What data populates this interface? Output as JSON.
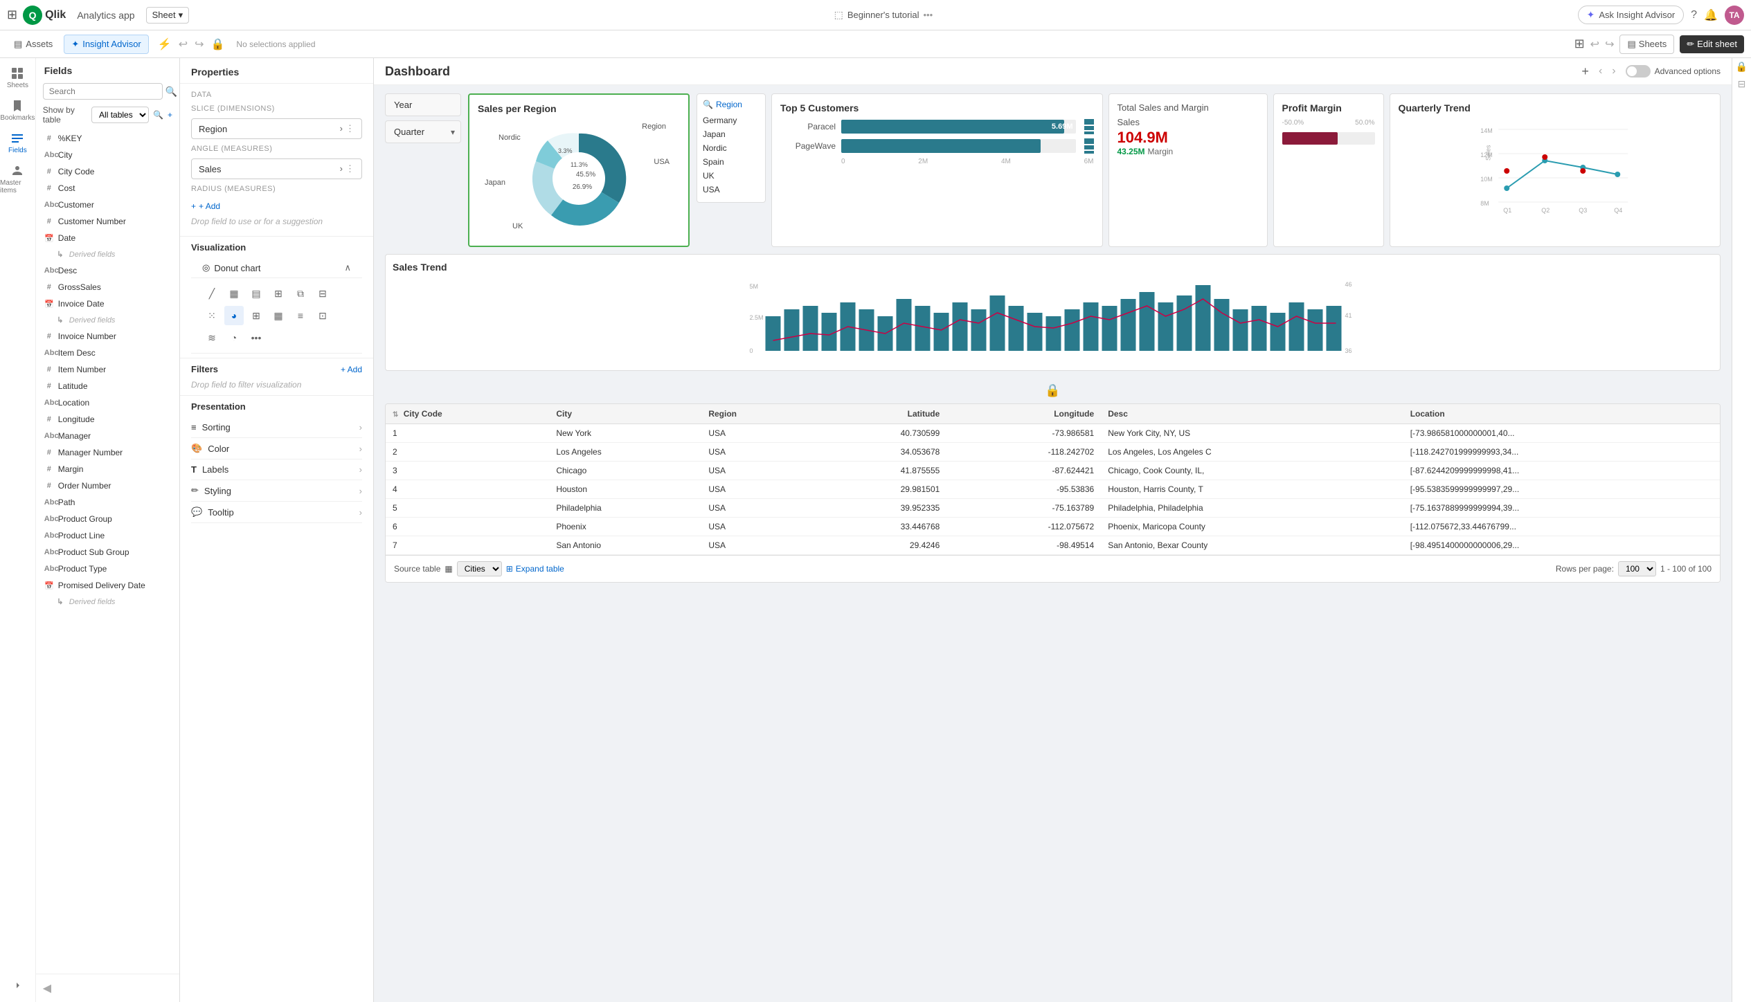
{
  "topNav": {
    "gridIcon": "⊞",
    "appName": "Analytics app",
    "sheetLabel": "Sheet",
    "tutorialLabel": "Beginner's tutorial",
    "insightAdvisorPlaceholder": "Ask Insight Advisor",
    "helpIcon": "?",
    "bellIcon": "🔔",
    "avatarInitials": "TA"
  },
  "secondNav": {
    "assetsLabel": "Assets",
    "insightLabel": "Insight Advisor",
    "noSelectionsLabel": "No selections applied",
    "sheetsLabel": "Sheets",
    "editSheetLabel": "Edit sheet"
  },
  "fieldsPanel": {
    "title": "Fields",
    "searchPlaceholder": "Search",
    "showByTable": "Show by table",
    "allTables": "All tables",
    "fields": [
      {
        "icon": "#",
        "name": "%KEY"
      },
      {
        "icon": "Abc",
        "name": "City"
      },
      {
        "icon": "#",
        "name": "City Code"
      },
      {
        "icon": "#",
        "name": "Cost"
      },
      {
        "icon": "Abc",
        "name": "Customer"
      },
      {
        "icon": "#",
        "name": "Customer Number"
      },
      {
        "icon": "📅",
        "name": "Date"
      },
      {
        "icon": "→",
        "name": "Derived fields",
        "sub": true
      },
      {
        "icon": "Abc",
        "name": "Desc"
      },
      {
        "icon": "#",
        "name": "GrossSales"
      },
      {
        "icon": "📅",
        "name": "Invoice Date"
      },
      {
        "icon": "→",
        "name": "Derived fields",
        "sub": true
      },
      {
        "icon": "#",
        "name": "Invoice Number"
      },
      {
        "icon": "Abc",
        "name": "Item Desc"
      },
      {
        "icon": "#",
        "name": "Item Number"
      },
      {
        "icon": "#",
        "name": "Latitude"
      },
      {
        "icon": "Abc",
        "name": "Location"
      },
      {
        "icon": "#",
        "name": "Longitude"
      },
      {
        "icon": "Abc",
        "name": "Manager"
      },
      {
        "icon": "#",
        "name": "Manager Number"
      },
      {
        "icon": "#",
        "name": "Margin"
      },
      {
        "icon": "#",
        "name": "Order Number"
      },
      {
        "icon": "Abc",
        "name": "Path"
      },
      {
        "icon": "Abc",
        "name": "Product Group"
      },
      {
        "icon": "Abc",
        "name": "Product Line"
      },
      {
        "icon": "Abc",
        "name": "Product Sub Group"
      },
      {
        "icon": "Abc",
        "name": "Product Type"
      },
      {
        "icon": "📅",
        "name": "Promised Delivery Date"
      },
      {
        "icon": "Abc",
        "name": "Derived fields",
        "sub": true
      }
    ]
  },
  "propertiesPanel": {
    "title": "Properties",
    "dataLabel": "Data",
    "sliceDimLabel": "Slice (Dimensions)",
    "sliceField": "Region",
    "angleMeasLabel": "Angle (Measures)",
    "angleField": "Sales",
    "radiusMeasLabel": "Radius (Measures)",
    "addLabel": "+ Add",
    "dropFieldHint": "Drop field to use or for a suggestion",
    "vizLabel": "Visualization",
    "donutLabel": "Donut chart",
    "filtersLabel": "Filters",
    "addFilterLabel": "+ Add",
    "dropFilterHint": "Drop field to filter visualization",
    "presentationLabel": "Presentation",
    "presItems": [
      {
        "icon": "≡",
        "label": "Sorting"
      },
      {
        "icon": "🎨",
        "label": "Color"
      },
      {
        "icon": "T",
        "label": "Labels"
      },
      {
        "icon": "✏️",
        "label": "Styling"
      },
      {
        "icon": "💬",
        "label": "Tooltip"
      }
    ]
  },
  "dashboard": {
    "title": "Dashboard",
    "addIcon": "+",
    "advancedLabel": "Advanced options"
  },
  "yearQuarter": {
    "yearLabel": "Year",
    "quarterLabel": "Quarter"
  },
  "salesPerRegion": {
    "title": "Sales per Region",
    "regionLabel": "Region",
    "segments": [
      {
        "label": "USA",
        "pct": "45.5%",
        "color": "#2a7a8c"
      },
      {
        "label": "UK",
        "pct": "26.9%",
        "color": "#3a9cb0"
      },
      {
        "label": "Nordic",
        "pct": "3.3%",
        "color": "#7fccd9"
      },
      {
        "label": "Japan",
        "pct": "11.3%",
        "color": "#b0dce6"
      }
    ]
  },
  "top5Customers": {
    "title": "Top 5 Customers",
    "bars": [
      {
        "label": "Paracel",
        "value": 5.69,
        "displayVal": "5.69M",
        "pct": 95
      },
      {
        "label": "PageWave",
        "value": 5.1,
        "displayVal": "",
        "pct": 85
      }
    ],
    "axis": [
      "0",
      "2M",
      "4M",
      "6M"
    ]
  },
  "totalSales": {
    "title": "Total Sales and Margin",
    "salesLabel": "Sales",
    "salesValue": "104.9M",
    "marginValue": "43.25M",
    "marginLabel": "Margin"
  },
  "profitMargin": {
    "title": "Profit Margin",
    "leftLabel": "-50.0%",
    "rightLabel": "50.0%"
  },
  "quarterlyTrend": {
    "title": "Quarterly Trend",
    "yLabels": [
      "14M",
      "12M",
      "10M",
      "8M"
    ],
    "xLabels": [
      "Q1",
      "Q2",
      "Q3",
      "Q4"
    ],
    "salesAxisLabel": "Sales"
  },
  "salesTrend": {
    "title": "Sales Trend",
    "yLabels": [
      "5M",
      "2.5M",
      "0"
    ],
    "rightLabels": [
      "46",
      "41",
      "36"
    ]
  },
  "regionFilter": {
    "header": "Region",
    "items": [
      "Germany",
      "Japan",
      "Nordic",
      "Spain",
      "UK",
      "USA"
    ]
  },
  "dataTable": {
    "lockIcon": "🔒",
    "columns": [
      "City Code",
      "City",
      "Region",
      "Latitude",
      "Longitude",
      "Desc",
      "Location"
    ],
    "rows": [
      {
        "cityCode": "1",
        "city": "New York",
        "region": "USA",
        "lat": "40.730599",
        "lng": "-73.986581",
        "desc": "New York City, NY, US",
        "location": "[-73.986581000000001,40..."
      },
      {
        "cityCode": "2",
        "city": "Los Angeles",
        "region": "USA",
        "lat": "34.053678",
        "lng": "-118.242702",
        "desc": "Los Angeles, Los Angeles C",
        "location": "[-118.242701999999993,34..."
      },
      {
        "cityCode": "3",
        "city": "Chicago",
        "region": "USA",
        "lat": "41.875555",
        "lng": "-87.624421",
        "desc": "Chicago, Cook County, IL,",
        "location": "[-87.6244209999999998,41..."
      },
      {
        "cityCode": "4",
        "city": "Houston",
        "region": "USA",
        "lat": "29.981501",
        "lng": "-95.53836",
        "desc": "Houston, Harris County, T",
        "location": "[-95.5383599999999997,29..."
      },
      {
        "cityCode": "5",
        "city": "Philadelphia",
        "region": "USA",
        "lat": "39.952335",
        "lng": "-75.163789",
        "desc": "Philadelphia, Philadelphia",
        "location": "[-75.1637889999999994,39..."
      },
      {
        "cityCode": "6",
        "city": "Phoenix",
        "region": "USA",
        "lat": "33.446768",
        "lng": "-112.075672",
        "desc": "Phoenix, Maricopa County",
        "location": "[-112.075672,33.44676799..."
      },
      {
        "cityCode": "7",
        "city": "San Antonio",
        "region": "USA",
        "lat": "29.4246",
        "lng": "-98.49514",
        "desc": "San Antonio, Bexar County",
        "location": "[-98.4951400000000006,29..."
      }
    ],
    "sourceTable": "Cities",
    "expandTable": "Expand table",
    "rowsPerPage": "100",
    "pageInfo": "1 - 100 of 100"
  }
}
